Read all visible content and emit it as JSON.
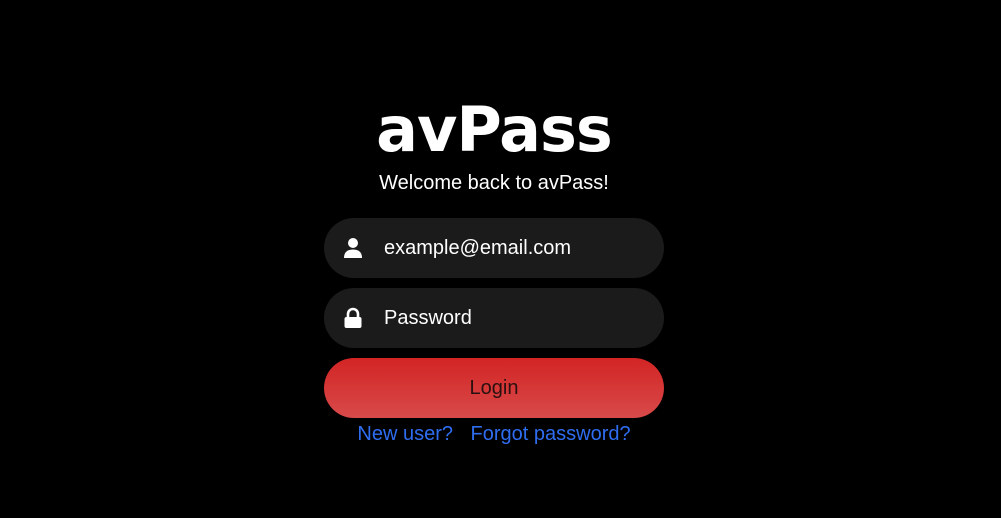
{
  "app": {
    "title": "avPass",
    "subtitle": "Welcome back to avPass!"
  },
  "form": {
    "email": {
      "value": "",
      "placeholder": "example@email.com",
      "icon": "user-icon"
    },
    "password": {
      "value": "",
      "placeholder": "Password",
      "icon": "lock-icon"
    },
    "login_label": "Login"
  },
  "links": {
    "new_user": "New user?",
    "forgot_password": "Forgot password?"
  },
  "colors": {
    "background": "#000000",
    "field_background": "#1b1b1b",
    "button_top": "#d32424",
    "button_bottom": "#d84a4a",
    "link": "#2f6df0",
    "text": "#ffffff"
  }
}
